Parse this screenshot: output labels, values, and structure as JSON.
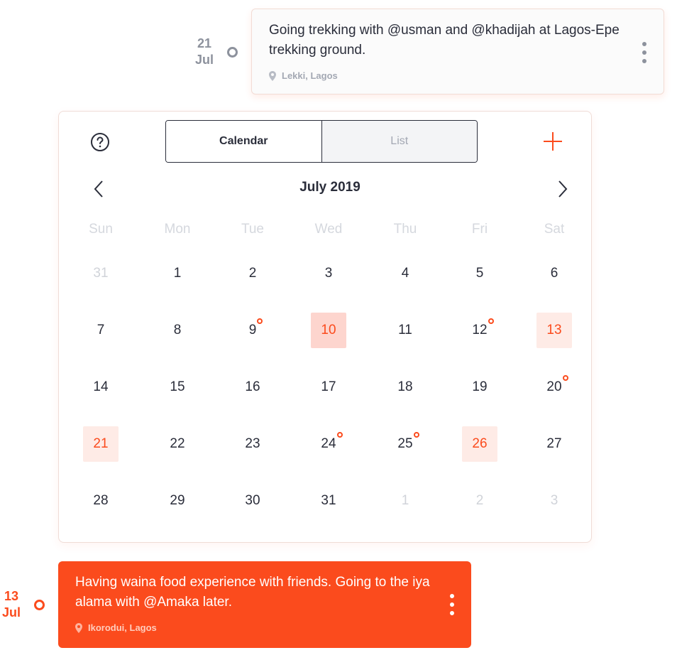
{
  "events": [
    {
      "day": "21",
      "month": "Jul",
      "text": "Going trekking with @usman and @khadijah at Lagos-Epe trekking ground.",
      "location": "Lekki, Lagos"
    },
    {
      "day": "13",
      "month": "Jul",
      "text": "Having waina food experience with friends. Going to the iya alama with @Amaka later.",
      "location": "Ikorodui, Lagos"
    }
  ],
  "calendar": {
    "toggle": {
      "calendar_label": "Calendar",
      "list_label": "List",
      "active": "Calendar"
    },
    "icons": {
      "help": "question-circle-icon",
      "add": "plus-icon",
      "prev": "chevron-left-icon",
      "next": "chevron-right-icon",
      "location": "map-pin-icon",
      "more": "more-vertical-icon"
    },
    "month_title": "July 2019",
    "weekdays": [
      "Sun",
      "Mon",
      "Tue",
      "Wed",
      "Thu",
      "Fri",
      "Sat"
    ],
    "weeks": [
      [
        "31",
        "1",
        "2",
        "3",
        "4",
        "5",
        "6"
      ],
      [
        "7",
        "8",
        "9",
        "10",
        "11",
        "12",
        "13"
      ],
      [
        "14",
        "15",
        "16",
        "17",
        "18",
        "19",
        "20"
      ],
      [
        "21",
        "22",
        "23",
        "24",
        "25",
        "26",
        "27"
      ],
      [
        "28",
        "29",
        "30",
        "31",
        "1",
        "2",
        "3"
      ]
    ],
    "outside_month_days": [
      "31 (prev)",
      "1 (next)",
      "2 (next)",
      "3 (next)"
    ],
    "selected_days": [
      "10",
      "13",
      "21",
      "26"
    ],
    "today": "10",
    "days_with_events": [
      "9",
      "12",
      "20",
      "24",
      "25"
    ]
  },
  "colors": {
    "accent": "#fb4b1d",
    "text": "#2a2d3a",
    "muted": "#d0d3d9",
    "selected_bg": "#feebe6",
    "today_bg": "#fdd5ce",
    "timeline_grey": "#8d929d"
  }
}
